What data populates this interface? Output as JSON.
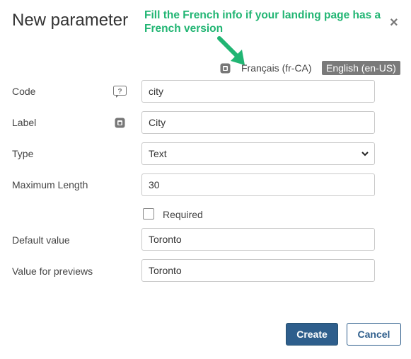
{
  "dialog": {
    "title": "New parameter",
    "close_glyph": "×"
  },
  "annotation": {
    "text": "Fill the French info if your landing page has a French version",
    "color": "#21b573"
  },
  "languages": {
    "french": "Français (fr-CA)",
    "english": "English (en-US)",
    "active": "English (en-US)"
  },
  "form": {
    "code": {
      "label": "Code",
      "value": "city"
    },
    "label": {
      "label": "Label",
      "value": "City"
    },
    "type": {
      "label": "Type",
      "value": "Text",
      "options": [
        "Text"
      ]
    },
    "max_length": {
      "label": "Maximum Length",
      "value": "30"
    },
    "required": {
      "label": "Required",
      "checked": false
    },
    "default_value": {
      "label": "Default value",
      "value": "Toronto"
    },
    "preview_value": {
      "label": "Value for previews",
      "value": "Toronto"
    }
  },
  "buttons": {
    "create": "Create",
    "cancel": "Cancel"
  },
  "colors": {
    "primary": "#2e5e8c",
    "active_language_bg": "#7a7a7a"
  }
}
